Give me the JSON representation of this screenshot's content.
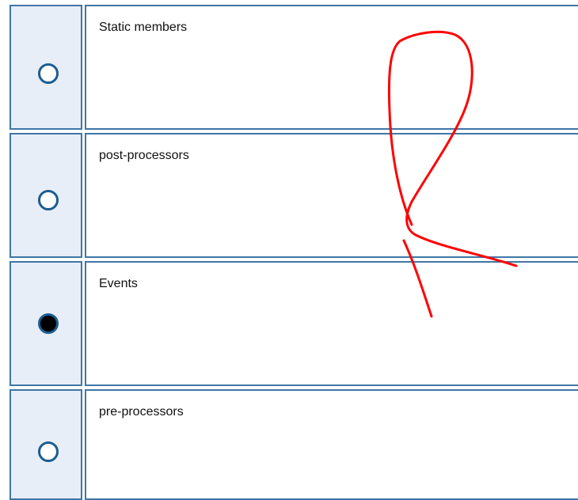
{
  "options": [
    {
      "label": "Static members",
      "selected": false
    },
    {
      "label": "post-processors",
      "selected": false
    },
    {
      "label": "Events",
      "selected": true
    },
    {
      "label": "pre-processors",
      "selected": false
    }
  ],
  "annotation": {
    "color": "#ff0000",
    "description_icon": "hand-drawn-mark-icon"
  },
  "colors": {
    "cell_border": "#3f76a6",
    "radio_cell_bg": "#e8eef7",
    "radio_border": "#1c5d91",
    "radio_selected_fill": "#000000"
  }
}
